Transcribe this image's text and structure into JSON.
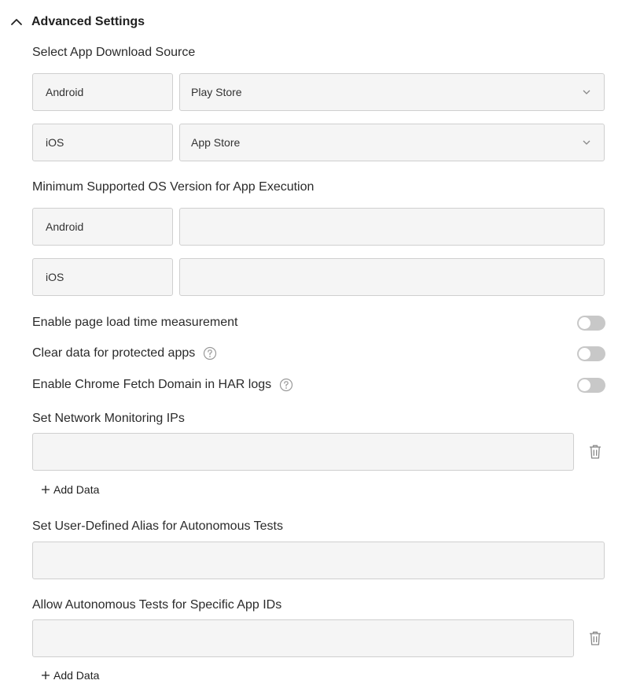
{
  "header": {
    "title": "Advanced Settings",
    "icon": "chevron-up-icon"
  },
  "download_source": {
    "label": "Select App Download Source",
    "rows": [
      {
        "platform": "Android",
        "value": "Play Store"
      },
      {
        "platform": "iOS",
        "value": "App Store"
      }
    ]
  },
  "min_os": {
    "label": "Minimum Supported OS Version for App Execution",
    "rows": [
      {
        "platform": "Android",
        "value": ""
      },
      {
        "platform": "iOS",
        "value": ""
      }
    ]
  },
  "toggles": [
    {
      "label": "Enable page load time measurement",
      "enabled": false,
      "help": false
    },
    {
      "label": "Clear data for protected apps",
      "enabled": false,
      "help": true
    },
    {
      "label": "Enable Chrome Fetch Domain in HAR logs",
      "enabled": false,
      "help": true
    }
  ],
  "network_ips": {
    "label": "Set Network Monitoring IPs",
    "value": "",
    "add_label": "Add Data"
  },
  "alias": {
    "label": "Set User-Defined Alias for Autonomous Tests",
    "value": ""
  },
  "app_ids": {
    "label": "Allow Autonomous Tests for Specific App IDs",
    "value": "",
    "add_label": "Add Data"
  }
}
